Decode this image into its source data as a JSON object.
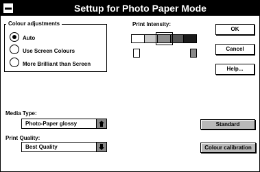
{
  "window": {
    "title": "Settup for Photo Paper Mode"
  },
  "colour_adjustments": {
    "label": "Colour adjustments",
    "options": [
      {
        "label": "Auto",
        "selected": true
      },
      {
        "label": "Use Screen Colours",
        "selected": false
      },
      {
        "label": "More Brilliant than Screen",
        "selected": false
      }
    ]
  },
  "print_intensity": {
    "label": "Print Intensity:",
    "swatch_colors": [
      "#ffffff",
      "#c8c8c8",
      "#8c8c8c",
      "#555555",
      "#1a1a1a"
    ],
    "selected_index": 2,
    "light_indicator_color": "#ffffff",
    "dark_indicator_color": "#888888"
  },
  "buttons": {
    "ok": "OK",
    "cancel": "Cancel",
    "help": "Help...",
    "standard": "Standard",
    "colour_calibration": "Colour calibration"
  },
  "media_type": {
    "label": "Media Type:",
    "value": "Photo-Paper glossy",
    "icon": "arrow-up-icon"
  },
  "print_quality": {
    "label": "Print Quality:",
    "value": "Best Quality",
    "icon": "arrow-down-icon"
  }
}
